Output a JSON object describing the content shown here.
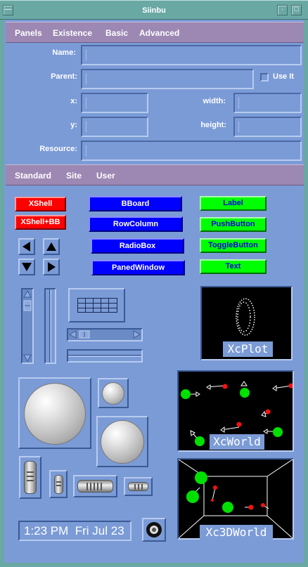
{
  "window": {
    "title": "Siinbu"
  },
  "menu_top": {
    "items": [
      "Panels",
      "Existence",
      "Basic",
      "Advanced"
    ]
  },
  "form": {
    "name_label": "Name:",
    "parent_label": "Parent:",
    "use_it_label": "Use It",
    "x_label": "x:",
    "width_label": "width:",
    "y_label": "y:",
    "height_label": "height:",
    "resource_label": "Resource:"
  },
  "menu_bottom": {
    "items": [
      "Standard",
      "Site",
      "User"
    ]
  },
  "palette": {
    "xshell": "XShell",
    "xshell_bb": "XShell+BB",
    "bboard": "BBoard",
    "rowcolumn": "RowColumn",
    "radiobox": "RadioBox",
    "panedwindow": "PanedWindow",
    "label": "Label",
    "pushbutton": "PushButton",
    "togglebutton": "ToggleButton",
    "text": "Text"
  },
  "widgets": {
    "xcplot": "XcPlot",
    "xcworld": "XcWorld",
    "xc3dworld": "Xc3DWorld",
    "clock": "1:23 PM  Fri Jul 23"
  },
  "colors": {
    "background": "#7b9bd6",
    "title_bar": "#6aa8a4",
    "menu_bar": "#9c88b3",
    "red_button": "#ff0000",
    "blue_button": "#0000ff",
    "green_button": "#00ff00"
  }
}
